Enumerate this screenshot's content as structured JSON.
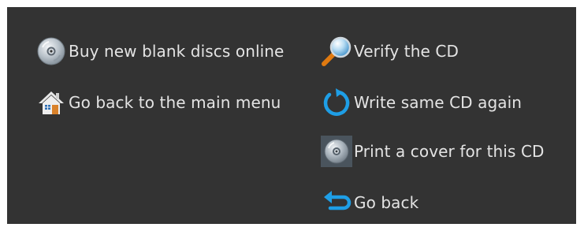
{
  "actions": {
    "buy_discs": {
      "label": "Buy new blank discs online",
      "icon": "disc-icon"
    },
    "main_menu": {
      "label": "Go back to the main menu",
      "icon": "home-icon"
    },
    "verify": {
      "label": "Verify the CD",
      "icon": "magnifier-icon"
    },
    "write_again": {
      "label": "Write same CD again",
      "icon": "refresh-icon"
    },
    "print_cover": {
      "label": "Print a cover for this CD",
      "icon": "disc-cover-icon"
    },
    "go_back": {
      "label": "Go back",
      "icon": "back-arrow-icon"
    }
  },
  "colors": {
    "panel_background": "#333333",
    "text": "#e4e4e4",
    "accent_blue": "#1e9ee6"
  }
}
